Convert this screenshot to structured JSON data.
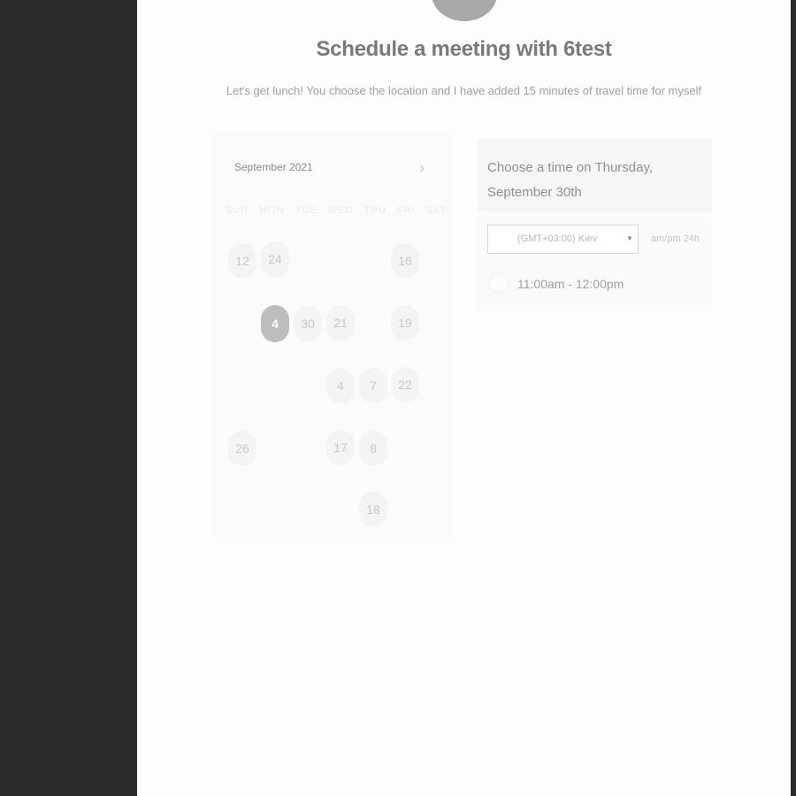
{
  "header": {
    "title": "Schedule a meeting with 6test",
    "description": "Let's get lunch! You choose the location and I have added 15 minutes of travel time for myself"
  },
  "calendar": {
    "month_label": "September 2021",
    "next_icon": "chevron-right-icon",
    "weekdays": [
      "SUN",
      "MON",
      "TUE",
      "WED",
      "THU",
      "FRI",
      "SAT"
    ],
    "days": [
      "12",
      "24",
      "16",
      "4",
      "30",
      "21",
      "19",
      "4",
      "7",
      "22",
      "26",
      "17",
      "8",
      "18"
    ],
    "selected_day": "4"
  },
  "time_panel": {
    "heading": "Choose a time on Thursday, September 30th",
    "timezone": "(GMT+03:00) Kiev",
    "format_toggle": "am/pm 24h",
    "slots": [
      "11:00am - 12:00pm"
    ]
  },
  "colors": {
    "selected_day": "#bdbdbd",
    "sidebar": "#2b2b2b"
  }
}
